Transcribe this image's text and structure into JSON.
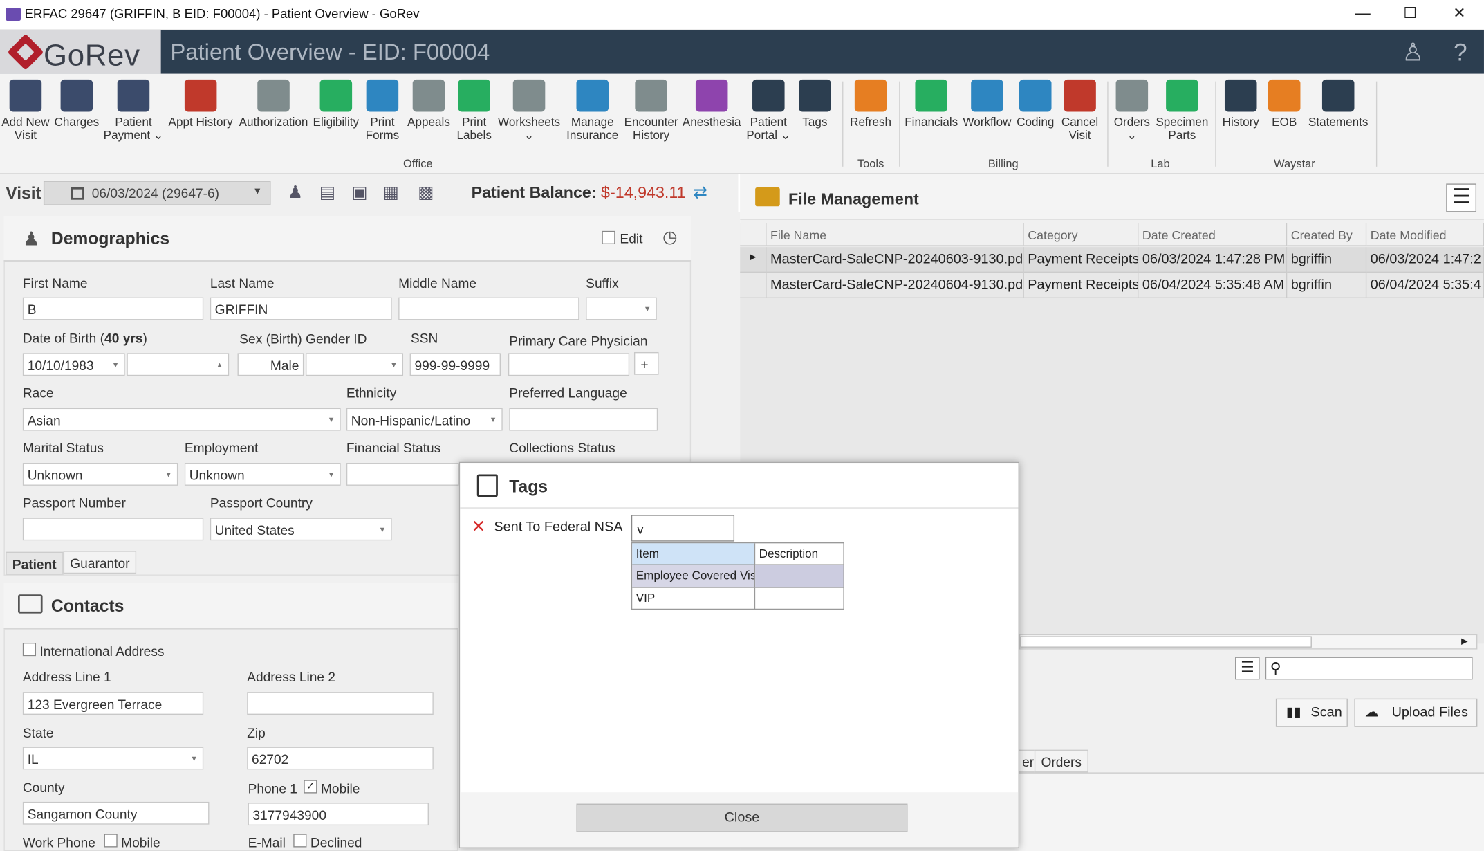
{
  "window": {
    "title": "ERFAC 29647 (GRIFFIN, B EID: F00004) - Patient Overview - GoRev",
    "minimize": "—",
    "maximize": "☐",
    "close": "✕"
  },
  "header": {
    "logo_text": "GoRev",
    "page_title": "Patient Overview - EID: F00004",
    "user_icon": "ribbon-person-icon",
    "help_label": "?"
  },
  "ribbon": {
    "office": [
      {
        "label": "Add New\nVisit",
        "icon": "add-visit-icon",
        "color": "#3b4b6b"
      },
      {
        "label": "Charges",
        "icon": "barcode-icon",
        "color": "#3b4b6b"
      },
      {
        "label": "Patient\nPayment ⌄",
        "icon": "payment-icon",
        "color": "#3b4b6b"
      },
      {
        "label": "Appt History",
        "icon": "calendar-icon",
        "color": "#c0392b"
      },
      {
        "label": "Authorization",
        "icon": "shield-icon",
        "color": "#7f8c8d"
      },
      {
        "label": "Eligibility",
        "icon": "person-check-icon",
        "color": "#27ae60"
      },
      {
        "label": "Print\nForms",
        "icon": "printer-icon",
        "color": "#2e86c1"
      },
      {
        "label": "Appeals",
        "icon": "documents-icon",
        "color": "#7f8c8d"
      },
      {
        "label": "Print\nLabels",
        "icon": "label-icon",
        "color": "#27ae60"
      },
      {
        "label": "Worksheets\n⌄",
        "icon": "worksheet-icon",
        "color": "#7f8c8d"
      },
      {
        "label": "Manage\nInsurance",
        "icon": "insurance-icon",
        "color": "#2e86c1"
      },
      {
        "label": "Encounter\nHistory",
        "icon": "encounter-icon",
        "color": "#7f8c8d"
      },
      {
        "label": "Anesthesia",
        "icon": "syringe-icon",
        "color": "#8e44ad"
      },
      {
        "label": "Patient\nPortal ⌄",
        "icon": "globe-icon",
        "color": "#2c3e50"
      },
      {
        "label": "Tags",
        "icon": "tags-icon",
        "color": "#2c3e50"
      }
    ],
    "tools": [
      {
        "label": "Refresh",
        "icon": "refresh-icon",
        "color": "#e67e22"
      }
    ],
    "billing": [
      {
        "label": "Financials",
        "icon": "dollar-icon",
        "color": "#27ae60"
      },
      {
        "label": "Workflow",
        "icon": "workflow-icon",
        "color": "#2e86c1"
      },
      {
        "label": "Coding",
        "icon": "coding-book-icon",
        "color": "#2e86c1"
      },
      {
        "label": "Cancel\nVisit",
        "icon": "cancel-visit-icon",
        "color": "#c0392b"
      }
    ],
    "lab": [
      {
        "label": "Orders\n⌄",
        "icon": "orders-icon",
        "color": "#7f8c8d"
      },
      {
        "label": "Specimen\nParts",
        "icon": "specimen-icon",
        "color": "#27ae60"
      }
    ],
    "waystar": [
      {
        "label": "History",
        "icon": "clock-icon",
        "color": "#2c3e50"
      },
      {
        "label": "EOB",
        "icon": "eob-icon",
        "color": "#e67e22"
      },
      {
        "label": "Statements",
        "icon": "statements-icon",
        "color": "#2c3e50"
      }
    ],
    "groups": {
      "office": "Office",
      "tools": "Tools",
      "billing": "Billing",
      "lab": "Lab",
      "waystar": "Waystar"
    }
  },
  "visit": {
    "label": "Visit",
    "selected": "06/03/2024 (29647-6)",
    "balance_label": "Patient Balance:",
    "balance_value": "$-14,943.11"
  },
  "demographics": {
    "title": "Demographics",
    "edit_label": "Edit",
    "first_name_label": "First Name",
    "first_name": "B",
    "last_name_label": "Last Name",
    "last_name": "GRIFFIN",
    "middle_name_label": "Middle Name",
    "middle_name": "",
    "suffix_label": "Suffix",
    "suffix": "",
    "dob_label_prefix": "Date of Birth (",
    "dob_age": "40 yrs",
    "dob_label_suffix": ")",
    "dob": "10/10/1983",
    "sex_label": "Sex (Birth)",
    "sex": "Male",
    "gender_label": "Gender ID",
    "gender": "",
    "ssn_label": "SSN",
    "ssn": "999-99-9999",
    "pcp_label": "Primary Care Physician",
    "pcp": "",
    "pcp_add": "+",
    "race_label": "Race",
    "race": "Asian",
    "ethnicity_label": "Ethnicity",
    "ethnicity": "Non-Hispanic/Latino",
    "language_label": "Preferred Language",
    "language": "",
    "marital_label": "Marital Status",
    "marital": "Unknown",
    "employment_label": "Employment",
    "employment": "Unknown",
    "financial_label": "Financial Status",
    "financial": "",
    "collections_label": "Collections Status",
    "passport_label": "Passport Number",
    "passport": "",
    "passport_country_label": "Passport Country",
    "passport_country": "United States",
    "tabs": [
      "Patient",
      "Guarantor"
    ]
  },
  "contacts": {
    "title": "Contacts",
    "intl_label": "International Address",
    "addr1_label": "Address Line 1",
    "addr1": "123 Evergreen Terrace",
    "addr2_label": "Address Line 2",
    "addr2": "",
    "state_label": "State",
    "state": "IL",
    "zip_label": "Zip",
    "zip": "62702",
    "county_label": "County",
    "county": "Sangamon County",
    "phone1_label": "Phone 1",
    "mobile_label": "Mobile",
    "phone1": "3177943900",
    "work_phone_label": "Work Phone",
    "mobile2_label": "Mobile",
    "email_label": "E-Mail",
    "declined_label": "Declined"
  },
  "file_management": {
    "title": "File Management",
    "columns": [
      "File Name",
      "Category",
      "Date Created",
      "Created By",
      "Date Modified"
    ],
    "rows": [
      [
        "MasterCard-SaleCNP-20240603-9130.pdf",
        "Payment Receipts",
        "06/03/2024 1:47:28 PM",
        "bgriffin",
        "06/03/2024 1:47:2"
      ],
      [
        "MasterCard-SaleCNP-20240604-9130.pdf",
        "Payment Receipts",
        "06/04/2024 5:35:48 AM",
        "bgriffin",
        "06/04/2024 5:35:4"
      ]
    ],
    "scan_label": "Scan",
    "upload_label": "Upload Files",
    "lower_tabs": [
      "er",
      "Orders"
    ]
  },
  "tags_dialog": {
    "title": "Tags",
    "tag_name": "Sent To Federal NSA",
    "input_value": "v",
    "list_headers": [
      "Item",
      "Description"
    ],
    "list_items": [
      {
        "item": "Employee Covered Visit",
        "description": ""
      },
      {
        "item": "VIP",
        "description": ""
      }
    ],
    "close_label": "Close"
  }
}
